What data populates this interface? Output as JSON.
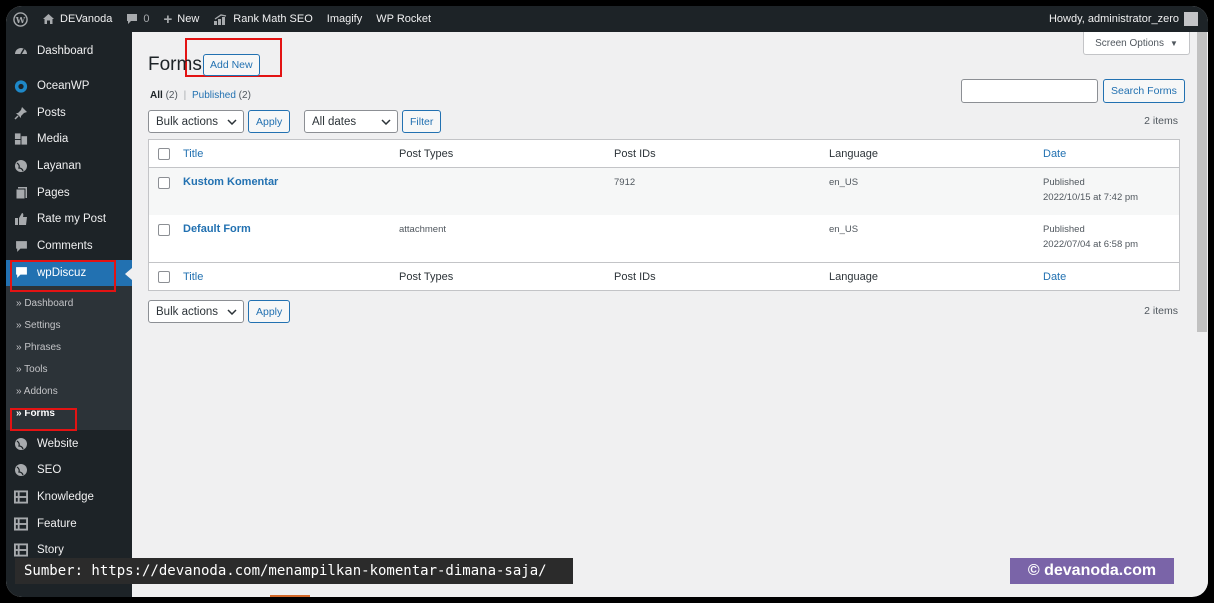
{
  "adminbar": {
    "site_name": "DEVanoda",
    "comments_count": "0",
    "new_label": "New",
    "rankmath_label": "Rank Math SEO",
    "imagify_label": "Imagify",
    "wprocket_label": "WP Rocket",
    "howdy": "Howdy, administrator_zero"
  },
  "sidebar": {
    "items_top": [
      {
        "label": "Dashboard",
        "icon": "dashboard-icon"
      },
      {
        "label": "OceanWP",
        "icon": "oceanwp-icon"
      },
      {
        "label": "Posts",
        "icon": "pin-icon"
      },
      {
        "label": "Media",
        "icon": "media-icon"
      },
      {
        "label": "Layanan",
        "icon": "globe-icon"
      },
      {
        "label": "Pages",
        "icon": "pages-icon"
      },
      {
        "label": "Rate my Post",
        "icon": "thumbs-up-icon"
      },
      {
        "label": "Comments",
        "icon": "comment-icon"
      },
      {
        "label": "wpDiscuz",
        "icon": "comment-icon"
      }
    ],
    "submenu": [
      "» Dashboard",
      "» Settings",
      "» Phrases",
      "» Tools",
      "» Addons",
      "» Forms"
    ],
    "items_bottom": [
      {
        "label": "Website",
        "icon": "globe-icon"
      },
      {
        "label": "SEO",
        "icon": "globe-icon"
      },
      {
        "label": "Knowledge",
        "icon": "layout-icon"
      },
      {
        "label": "Feature",
        "icon": "layout-icon"
      },
      {
        "label": "Story",
        "icon": "layout-icon"
      }
    ]
  },
  "header": {
    "screen_options": "Screen Options",
    "title": "Forms",
    "add_new": "Add New"
  },
  "filters": {
    "all_label": "All",
    "all_count": "(2)",
    "separator": "|",
    "published_label": "Published",
    "published_count": "(2)",
    "search_button": "Search Forms",
    "search_value": "",
    "bulk_actions": "Bulk actions",
    "apply": "Apply",
    "all_dates": "All dates",
    "filter": "Filter",
    "items_count": "2 items"
  },
  "table": {
    "columns": [
      "Title",
      "Post Types",
      "Post IDs",
      "Language",
      "Date"
    ],
    "rows": [
      {
        "title": "Kustom Komentar",
        "post_types": "",
        "post_ids": "7912",
        "language": "en_US",
        "date_status": "Published",
        "date": "2022/10/15 at 7:42 pm"
      },
      {
        "title": "Default Form",
        "post_types": "attachment",
        "post_ids": "",
        "language": "en_US",
        "date_status": "Published",
        "date": "2022/07/04 at 6:58 pm"
      }
    ]
  },
  "overlay": {
    "source": "Sumber: https://devanoda.com/menampilkan-komentar-dimana-saja/",
    "brand": "© devanoda.com"
  },
  "colors": {
    "admin_dark": "#1d2327",
    "accent_blue": "#2271b1",
    "highlight_red": "#e31313",
    "brand_purple": "#7a64a8"
  }
}
